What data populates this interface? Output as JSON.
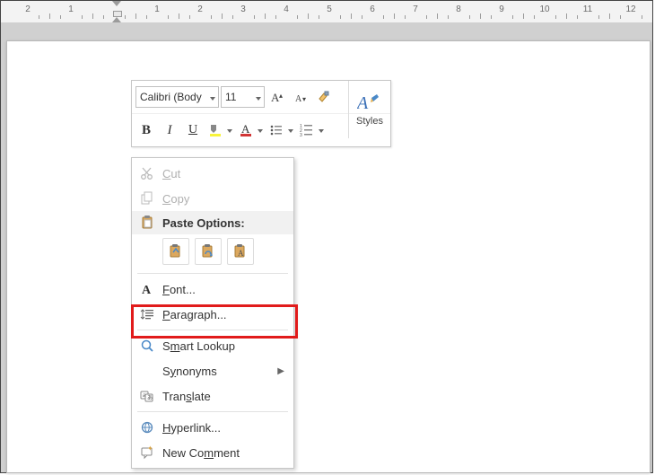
{
  "ruler": {
    "numbers": [
      "2",
      "1",
      "",
      "1",
      "2",
      "3",
      "4",
      "5",
      "6",
      "7",
      "8",
      "9",
      "10",
      "11",
      "12"
    ]
  },
  "miniToolbar": {
    "fontName": "Calibri (Body",
    "fontSize": "11",
    "stylesLabel": "Styles"
  },
  "contextMenu": {
    "cut": "Cut",
    "copy": "Copy",
    "pasteOptionsHeader": "Paste Options:",
    "font": "Font...",
    "paragraph": "Paragraph...",
    "smartLookup": "Smart Lookup",
    "synonyms": "Synonyms",
    "translate": "Translate",
    "hyperlink": "Hyperlink...",
    "newComment": "New Comment"
  }
}
